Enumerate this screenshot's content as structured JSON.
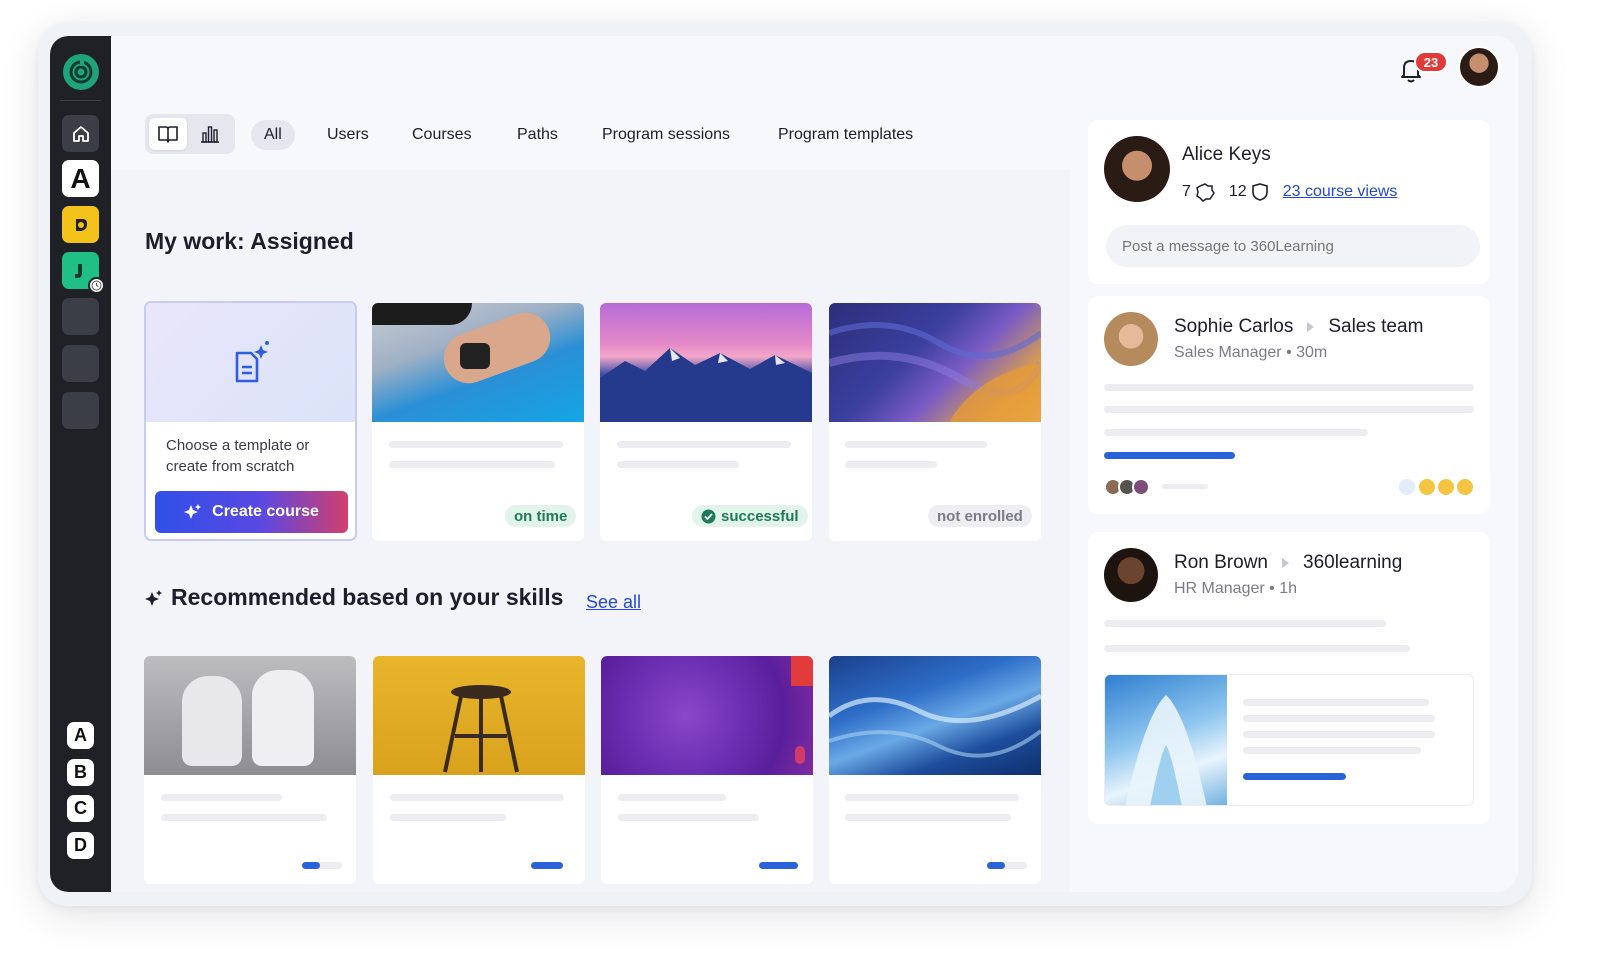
{
  "brand": {
    "accent": "#2348d6",
    "sidebar_bg": "#1f2126",
    "logo_green": "#1fa37a",
    "alert_red": "#e23a3a"
  },
  "sidebar": {
    "items": [
      {
        "icon": "home-icon"
      },
      {
        "label": "A",
        "icon": "letter-a-app-icon"
      },
      {
        "icon": "yellow-app-icon"
      },
      {
        "icon": "green-app-icon"
      }
    ],
    "letters": [
      "A",
      "B",
      "C",
      "D"
    ]
  },
  "header": {
    "notification_count": "23"
  },
  "tabs": [
    {
      "label": "All"
    },
    {
      "label": "Users"
    },
    {
      "label": "Courses"
    },
    {
      "label": "Paths"
    },
    {
      "label": "Program sessions"
    },
    {
      "label": "Program templates"
    }
  ],
  "my_work": {
    "title_bold": "My work:",
    "title_rest": " Assigned",
    "create_card": {
      "text": "Choose a template or create from scratch",
      "button_label": "Create course"
    },
    "cards": [
      {
        "status": "on time",
        "status_color": "#1f7a5c"
      },
      {
        "status": "successful",
        "status_color": "#1f7a5c"
      },
      {
        "status": "not enrolled",
        "status_color": "#7a7b86"
      }
    ]
  },
  "recommended": {
    "title": "Recommended based on your skills",
    "see_all": "See all",
    "cards": [
      {
        "progress": 0.45
      },
      {
        "progress": 1.0
      },
      {
        "progress": 1.0
      },
      {
        "progress": 0.45
      }
    ]
  },
  "profile": {
    "name": "Alice Keys",
    "stat_a": "7",
    "stat_b": "12",
    "course_views": "23 course views",
    "post_placeholder": "Post a message to 360Learning"
  },
  "feed": [
    {
      "name": "Sophie Carlos",
      "group": "Sales team",
      "role": "Sales Manager • 30m"
    },
    {
      "name": "Ron Brown",
      "group": "360learning",
      "role": "HR Manager • 1h"
    }
  ]
}
